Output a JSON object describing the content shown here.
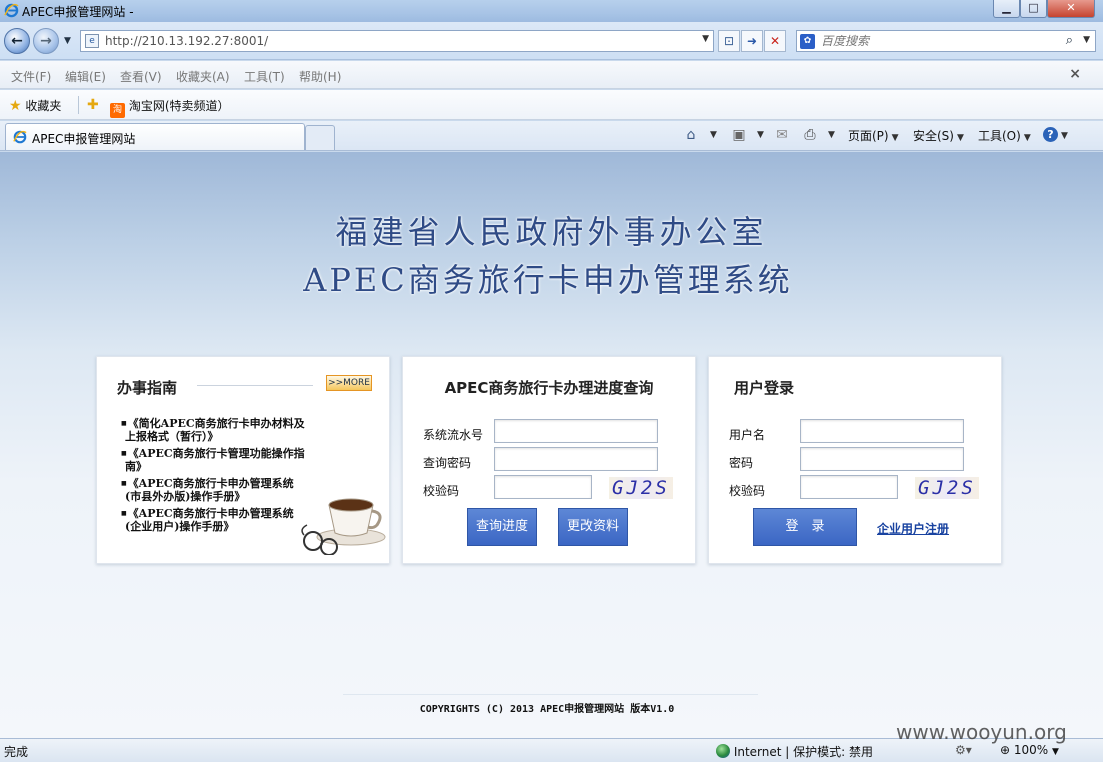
{
  "window": {
    "title": "APEC申报管理网站 -",
    "min": "▁",
    "max": "□",
    "close": "✕"
  },
  "address_bar": {
    "url": "http://210.13.192.27:8001/",
    "search_placeholder": "百度搜索"
  },
  "menu": {
    "items": [
      "文件(F)",
      "编辑(E)",
      "查看(V)",
      "收藏夹(A)",
      "工具(T)",
      "帮助(H)"
    ],
    "close": "×"
  },
  "favorites": {
    "label": "收藏夹",
    "taobao_icon": "淘",
    "taobao": "淘宝网(特卖频道）"
  },
  "tab": {
    "label": "APEC申报管理网站"
  },
  "commands": {
    "page": "页面(P)",
    "safety": "安全(S)",
    "tools": "工具(O)",
    "help_icon": "?"
  },
  "page": {
    "heading1": "福建省人民政府外事办公室",
    "heading2": "APEC商务旅行卡申办管理系统",
    "guide": {
      "title": "办事指南",
      "more": ">>MORE",
      "items": [
        "《简化APEC商务旅行卡申办材料及上报格式（暂行）》",
        "《APEC商务旅行卡管理功能操作指南》",
        "《APEC商务旅行卡申办管理系统(市县外办版)操作手册》",
        "《APEC商务旅行卡申办管理系统(企业用户)操作手册》"
      ]
    },
    "query": {
      "title": "APEC商务旅行卡办理进度查询",
      "serial_label": "系统流水号",
      "password_label": "查询密码",
      "captcha_label": "校验码",
      "captcha_text": "GJ2S",
      "query_button": "查询进度",
      "modify_button": "更改资料"
    },
    "login": {
      "title": "用户登录",
      "username_label": "用户名",
      "password_label": "密码",
      "captcha_label": "校验码",
      "captcha_text": "GJ2S",
      "login_button": "登　录",
      "register_link": "企业用户注册"
    },
    "footer": "COPYRIGHTS (C) 2013 APEC申报管理网站 版本V1.0"
  },
  "status": {
    "done": "完成",
    "zone": "Internet | 保护模式: 禁用",
    "zoom": "100%"
  },
  "watermark": "www.wooyun.org",
  "colors": {
    "heading": "#2f4b86",
    "button": "#3b66c4",
    "link": "#1842a0"
  }
}
